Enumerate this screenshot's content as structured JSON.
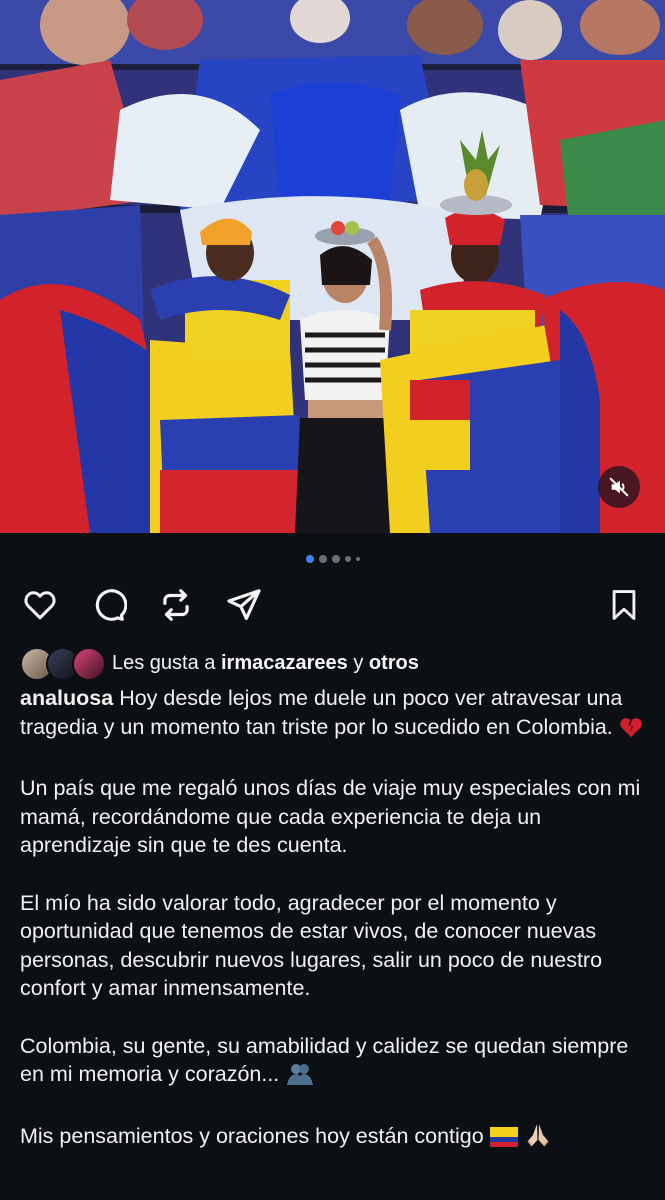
{
  "post": {
    "media": {
      "description_icon": "photo-carousel",
      "mute_icon": "speaker-muted-icon",
      "carousel_count": 5,
      "carousel_active_index": 0
    },
    "actions": {
      "like_icon": "heart-icon",
      "comment_icon": "comment-icon",
      "repost_icon": "repost-icon",
      "share_icon": "send-icon",
      "save_icon": "bookmark-icon"
    },
    "likes": {
      "prefix": "Les gusta a",
      "user": "irmacazarees",
      "connector": "y",
      "others": "otros"
    },
    "caption": {
      "username": "analuosa",
      "p1": "Hoy desde lejos me duele un poco ver atravesar una tragedia y un momento tan triste por lo sucedido en Colombia.",
      "p1_emoji": "broken-heart",
      "p2": "Un país que me regaló unos días de viaje muy especiales con mi mamá, recordándome que cada experiencia te deja un aprendizaje sin que te des cuenta.",
      "p3": "El mío ha sido valorar todo, agradecer por el momento y oportunidad que tenemos de estar vivos, de conocer nuevas personas, descubrir nuevos lugares, salir un poco de nuestro confort y amar inmensamente.",
      "p4": "Colombia, su gente, su amabilidad y calidez se quedan siempre en mi memoria y corazón...",
      "p4_emoji": "hugging-people",
      "p5": "Mis pensamientos y oraciones hoy están contigo",
      "p5_emojis": [
        "flag-colombia",
        "folded-hands"
      ]
    }
  },
  "colors": {
    "background": "#0c0f14",
    "accent_dot": "#3f86f5",
    "text": "#f5f5f5"
  }
}
